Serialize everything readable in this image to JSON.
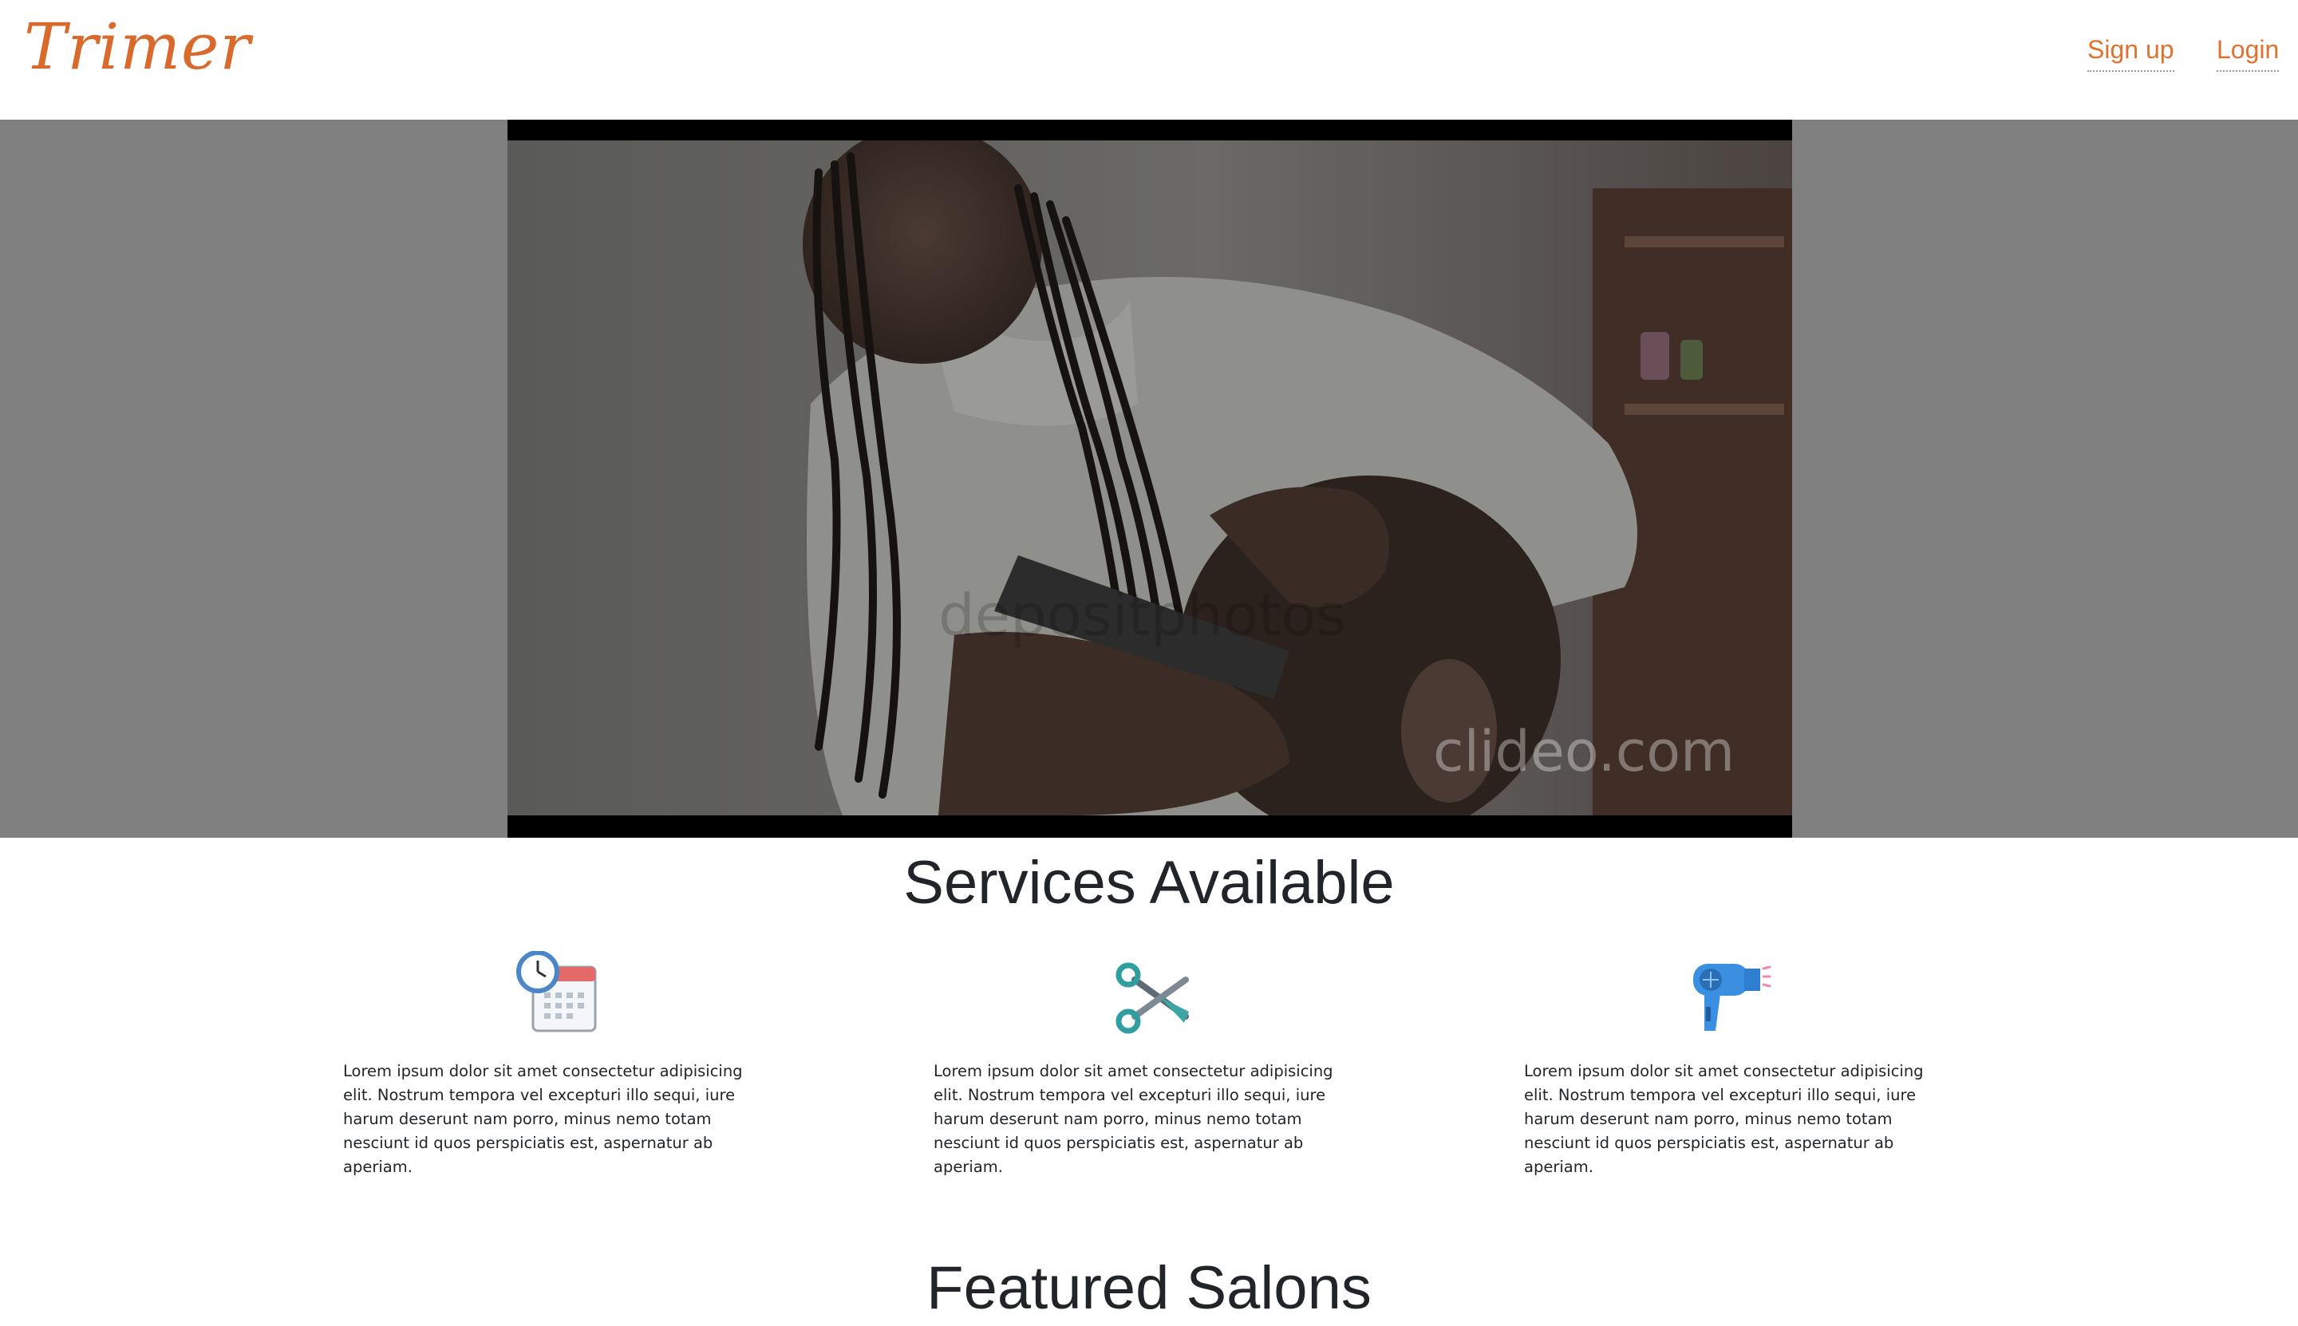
{
  "brand": {
    "name": "Trimer",
    "color": "#d96a2c"
  },
  "nav": {
    "items": [
      {
        "label": "Sign up"
      },
      {
        "label": "Login"
      }
    ],
    "link_color": "#e0712f"
  },
  "hero": {
    "overlay_color": "#808080",
    "video": {
      "watermarks": [
        "depositphotos",
        "clideo.com"
      ]
    }
  },
  "services": {
    "title": "Services Available",
    "items": [
      {
        "icon": "calendar-clock-icon",
        "text": "Lorem ipsum dolor sit amet consectetur adipisicing elit. Nostrum tempora vel excepturi illo sequi, iure harum deserunt nam porro, minus nemo totam nesciunt id quos perspiciatis est, aspernatur ab aperiam."
      },
      {
        "icon": "scissors-icon",
        "text": "Lorem ipsum dolor sit amet consectetur adipisicing elit. Nostrum tempora vel excepturi illo sequi, iure harum deserunt nam porro, minus nemo totam nesciunt id quos perspiciatis est, aspernatur ab aperiam."
      },
      {
        "icon": "hair-dryer-icon",
        "text": "Lorem ipsum dolor sit amet consectetur adipisicing elit. Nostrum tempora vel excepturi illo sequi, iure harum deserunt nam porro, minus nemo totam nesciunt id quos perspiciatis est, aspernatur ab aperiam."
      }
    ]
  },
  "featured": {
    "title": "Featured Salons"
  }
}
